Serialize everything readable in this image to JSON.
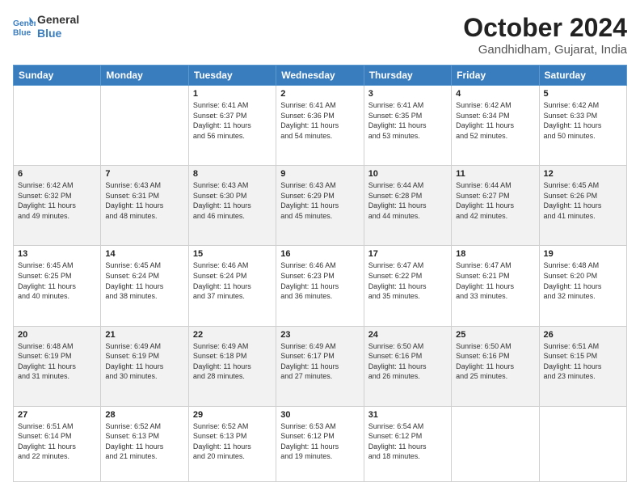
{
  "header": {
    "logo_line1": "General",
    "logo_line2": "Blue",
    "month": "October 2024",
    "location": "Gandhidham, Gujarat, India"
  },
  "weekdays": [
    "Sunday",
    "Monday",
    "Tuesday",
    "Wednesday",
    "Thursday",
    "Friday",
    "Saturday"
  ],
  "weeks": [
    [
      {
        "day": "",
        "info": ""
      },
      {
        "day": "",
        "info": ""
      },
      {
        "day": "1",
        "info": "Sunrise: 6:41 AM\nSunset: 6:37 PM\nDaylight: 11 hours and 56 minutes."
      },
      {
        "day": "2",
        "info": "Sunrise: 6:41 AM\nSunset: 6:36 PM\nDaylight: 11 hours and 54 minutes."
      },
      {
        "day": "3",
        "info": "Sunrise: 6:41 AM\nSunset: 6:35 PM\nDaylight: 11 hours and 53 minutes."
      },
      {
        "day": "4",
        "info": "Sunrise: 6:42 AM\nSunset: 6:34 PM\nDaylight: 11 hours and 52 minutes."
      },
      {
        "day": "5",
        "info": "Sunrise: 6:42 AM\nSunset: 6:33 PM\nDaylight: 11 hours and 50 minutes."
      }
    ],
    [
      {
        "day": "6",
        "info": "Sunrise: 6:42 AM\nSunset: 6:32 PM\nDaylight: 11 hours and 49 minutes."
      },
      {
        "day": "7",
        "info": "Sunrise: 6:43 AM\nSunset: 6:31 PM\nDaylight: 11 hours and 48 minutes."
      },
      {
        "day": "8",
        "info": "Sunrise: 6:43 AM\nSunset: 6:30 PM\nDaylight: 11 hours and 46 minutes."
      },
      {
        "day": "9",
        "info": "Sunrise: 6:43 AM\nSunset: 6:29 PM\nDaylight: 11 hours and 45 minutes."
      },
      {
        "day": "10",
        "info": "Sunrise: 6:44 AM\nSunset: 6:28 PM\nDaylight: 11 hours and 44 minutes."
      },
      {
        "day": "11",
        "info": "Sunrise: 6:44 AM\nSunset: 6:27 PM\nDaylight: 11 hours and 42 minutes."
      },
      {
        "day": "12",
        "info": "Sunrise: 6:45 AM\nSunset: 6:26 PM\nDaylight: 11 hours and 41 minutes."
      }
    ],
    [
      {
        "day": "13",
        "info": "Sunrise: 6:45 AM\nSunset: 6:25 PM\nDaylight: 11 hours and 40 minutes."
      },
      {
        "day": "14",
        "info": "Sunrise: 6:45 AM\nSunset: 6:24 PM\nDaylight: 11 hours and 38 minutes."
      },
      {
        "day": "15",
        "info": "Sunrise: 6:46 AM\nSunset: 6:24 PM\nDaylight: 11 hours and 37 minutes."
      },
      {
        "day": "16",
        "info": "Sunrise: 6:46 AM\nSunset: 6:23 PM\nDaylight: 11 hours and 36 minutes."
      },
      {
        "day": "17",
        "info": "Sunrise: 6:47 AM\nSunset: 6:22 PM\nDaylight: 11 hours and 35 minutes."
      },
      {
        "day": "18",
        "info": "Sunrise: 6:47 AM\nSunset: 6:21 PM\nDaylight: 11 hours and 33 minutes."
      },
      {
        "day": "19",
        "info": "Sunrise: 6:48 AM\nSunset: 6:20 PM\nDaylight: 11 hours and 32 minutes."
      }
    ],
    [
      {
        "day": "20",
        "info": "Sunrise: 6:48 AM\nSunset: 6:19 PM\nDaylight: 11 hours and 31 minutes."
      },
      {
        "day": "21",
        "info": "Sunrise: 6:49 AM\nSunset: 6:19 PM\nDaylight: 11 hours and 30 minutes."
      },
      {
        "day": "22",
        "info": "Sunrise: 6:49 AM\nSunset: 6:18 PM\nDaylight: 11 hours and 28 minutes."
      },
      {
        "day": "23",
        "info": "Sunrise: 6:49 AM\nSunset: 6:17 PM\nDaylight: 11 hours and 27 minutes."
      },
      {
        "day": "24",
        "info": "Sunrise: 6:50 AM\nSunset: 6:16 PM\nDaylight: 11 hours and 26 minutes."
      },
      {
        "day": "25",
        "info": "Sunrise: 6:50 AM\nSunset: 6:16 PM\nDaylight: 11 hours and 25 minutes."
      },
      {
        "day": "26",
        "info": "Sunrise: 6:51 AM\nSunset: 6:15 PM\nDaylight: 11 hours and 23 minutes."
      }
    ],
    [
      {
        "day": "27",
        "info": "Sunrise: 6:51 AM\nSunset: 6:14 PM\nDaylight: 11 hours and 22 minutes."
      },
      {
        "day": "28",
        "info": "Sunrise: 6:52 AM\nSunset: 6:13 PM\nDaylight: 11 hours and 21 minutes."
      },
      {
        "day": "29",
        "info": "Sunrise: 6:52 AM\nSunset: 6:13 PM\nDaylight: 11 hours and 20 minutes."
      },
      {
        "day": "30",
        "info": "Sunrise: 6:53 AM\nSunset: 6:12 PM\nDaylight: 11 hours and 19 minutes."
      },
      {
        "day": "31",
        "info": "Sunrise: 6:54 AM\nSunset: 6:12 PM\nDaylight: 11 hours and 18 minutes."
      },
      {
        "day": "",
        "info": ""
      },
      {
        "day": "",
        "info": ""
      }
    ]
  ]
}
